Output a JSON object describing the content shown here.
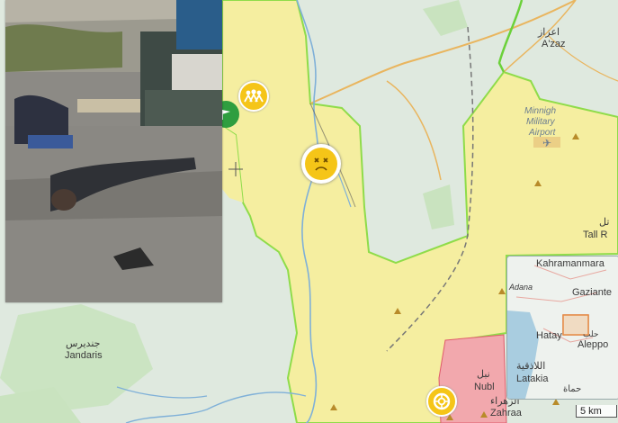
{
  "map": {
    "labels": {
      "azaz_ar": "اعزاز",
      "azaz": "A'zaz",
      "minnigh_line1": "Minnigh",
      "minnigh_line2": "Military",
      "minnigh_line3": "Airport",
      "jandaris_ar": "جنديرس",
      "jandaris": "Jandaris",
      "nubl_ar": "نبل",
      "nubl": "Nubl",
      "zahraa_ar": "الزهراء",
      "zahraa": "Zahraa",
      "tall_ar": "تل",
      "tall": "Tall R"
    },
    "colors": {
      "kurdish_yellow": "#f5eea0",
      "government_red": "#f2a8ad",
      "turkey_green": "#dfeadf",
      "river": "#7fb0d8",
      "road": "#e9b55e",
      "frontline_green": "#6bd13a"
    },
    "markers": {
      "protest_icon": "people-group-icon",
      "death_icon": "dead-face-icon",
      "refugee_icon": "lifebuoy-icon",
      "flag_icon": "flag-icon"
    }
  },
  "inset": {
    "kahramanmaras": "Kahramanmara",
    "gaziantep": "Gaziante",
    "adana": "Adana",
    "hatay": "Hatay",
    "aleppo_ar": "حلب",
    "aleppo": "Aleppo",
    "latakia_ar": "اللاذقية",
    "latakia": "Latakia",
    "hama_ar": "حماة"
  },
  "scale_bar": {
    "label": "5 km"
  }
}
